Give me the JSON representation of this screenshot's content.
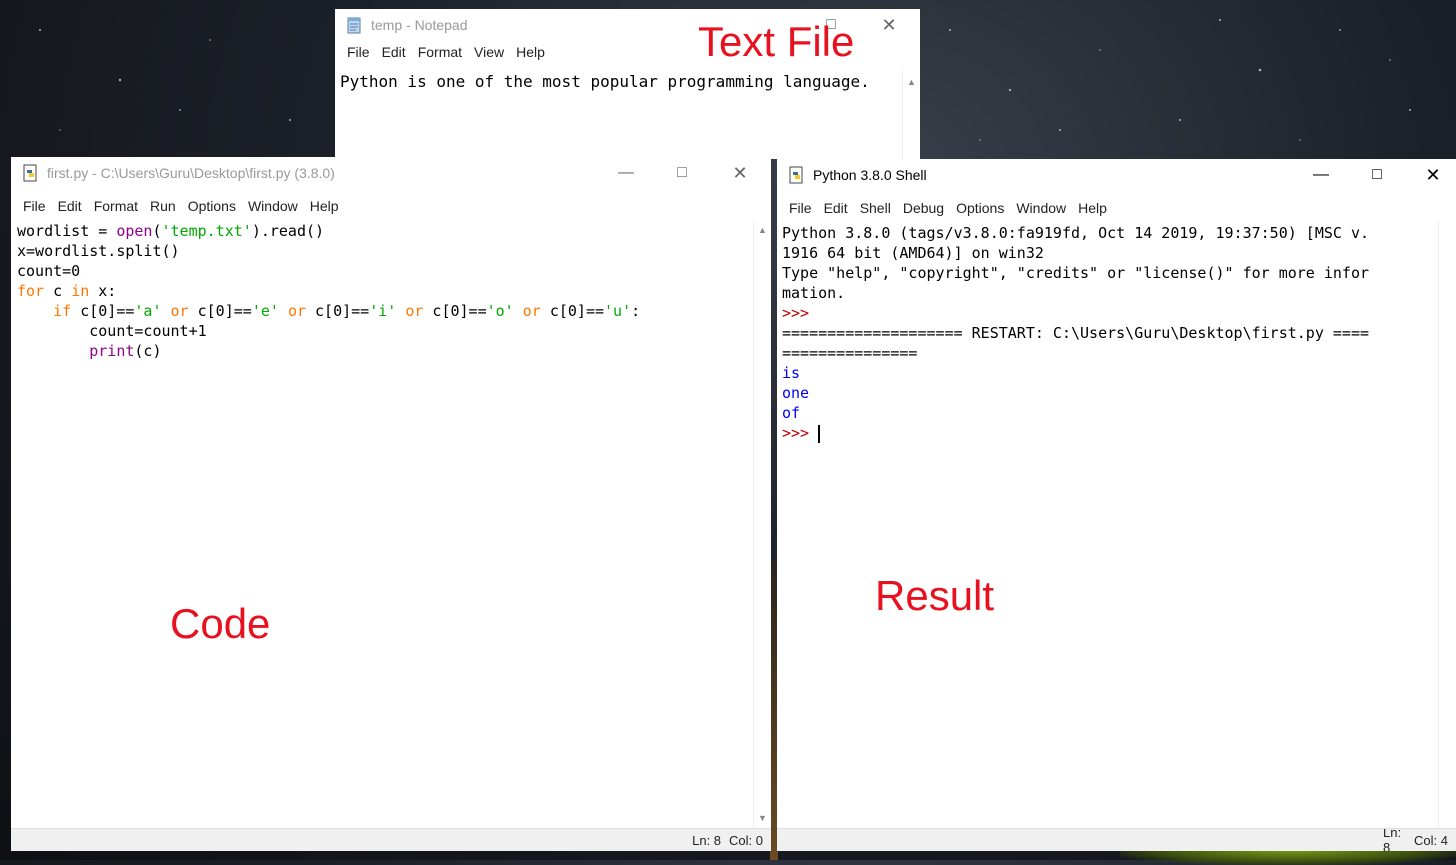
{
  "notepad": {
    "title": "temp - Notepad",
    "menu": [
      "File",
      "Edit",
      "Format",
      "View",
      "Help"
    ],
    "content": "Python is one of the most popular programming language."
  },
  "editor": {
    "title": "first.py - C:\\Users\\Guru\\Desktop\\first.py (3.8.0)",
    "menu": [
      "File",
      "Edit",
      "Format",
      "Run",
      "Options",
      "Window",
      "Help"
    ],
    "code": [
      [
        {
          "t": "wordlist = ",
          "c": ""
        },
        {
          "t": "open",
          "c": "bi"
        },
        {
          "t": "(",
          "c": ""
        },
        {
          "t": "'temp.txt'",
          "c": "str"
        },
        {
          "t": ").read()",
          "c": ""
        }
      ],
      [
        {
          "t": "x=wordlist.split()",
          "c": ""
        }
      ],
      [
        {
          "t": "count=0",
          "c": ""
        }
      ],
      [
        {
          "t": "for",
          "c": "kw"
        },
        {
          "t": " c ",
          "c": ""
        },
        {
          "t": "in",
          "c": "kw"
        },
        {
          "t": " x:",
          "c": ""
        }
      ],
      [
        {
          "t": "    ",
          "c": ""
        },
        {
          "t": "if",
          "c": "kw"
        },
        {
          "t": " c[0]==",
          "c": ""
        },
        {
          "t": "'a'",
          "c": "str"
        },
        {
          "t": " ",
          "c": ""
        },
        {
          "t": "or",
          "c": "kw"
        },
        {
          "t": " c[0]==",
          "c": ""
        },
        {
          "t": "'e'",
          "c": "str"
        },
        {
          "t": " ",
          "c": ""
        },
        {
          "t": "or",
          "c": "kw"
        },
        {
          "t": " c[0]==",
          "c": ""
        },
        {
          "t": "'i'",
          "c": "str"
        },
        {
          "t": " ",
          "c": ""
        },
        {
          "t": "or",
          "c": "kw"
        },
        {
          "t": " c[0]==",
          "c": ""
        },
        {
          "t": "'o'",
          "c": "str"
        },
        {
          "t": " ",
          "c": ""
        },
        {
          "t": "or",
          "c": "kw"
        },
        {
          "t": " c[0]==",
          "c": ""
        },
        {
          "t": "'u'",
          "c": "str"
        },
        {
          "t": ":",
          "c": ""
        }
      ],
      [
        {
          "t": "        count=count+1",
          "c": ""
        }
      ],
      [
        {
          "t": "        ",
          "c": ""
        },
        {
          "t": "print",
          "c": "bi"
        },
        {
          "t": "(c)",
          "c": ""
        }
      ]
    ],
    "status_ln": "Ln: 8",
    "status_col": "Col: 0"
  },
  "shell": {
    "title": "Python 3.8.0 Shell",
    "menu": [
      "File",
      "Edit",
      "Shell",
      "Debug",
      "Options",
      "Window",
      "Help"
    ],
    "lines": [
      {
        "t": "Python 3.8.0 (tags/v3.8.0:fa919fd, Oct 14 2019, 19:37:50) [MSC v.",
        "c": ""
      },
      {
        "t": "1916 64 bit (AMD64)] on win32",
        "c": ""
      },
      {
        "t": "Type \"help\", \"copyright\", \"credits\" or \"license()\" for more infor",
        "c": ""
      },
      {
        "t": "mation.",
        "c": ""
      },
      {
        "t": ">>>",
        "c": "prompt"
      },
      {
        "t": "==================== RESTART: C:\\Users\\Guru\\Desktop\\first.py ====",
        "c": ""
      },
      {
        "t": "===============",
        "c": ""
      },
      {
        "t": "is",
        "c": "out"
      },
      {
        "t": "one",
        "c": "out"
      },
      {
        "t": "of",
        "c": "out"
      },
      {
        "t": ">>> ",
        "c": "prompt"
      }
    ],
    "status_ln": "Ln: 8",
    "status_col": "Col: 4"
  },
  "annotations": {
    "text_file": "Text File",
    "code": "Code",
    "result": "Result"
  },
  "colors": {
    "keyword": "#ff7700",
    "builtin": "#900090",
    "string": "#00aa00",
    "output": "#0000ff",
    "prompt": "#c00000",
    "annotation": "#e8111f"
  }
}
